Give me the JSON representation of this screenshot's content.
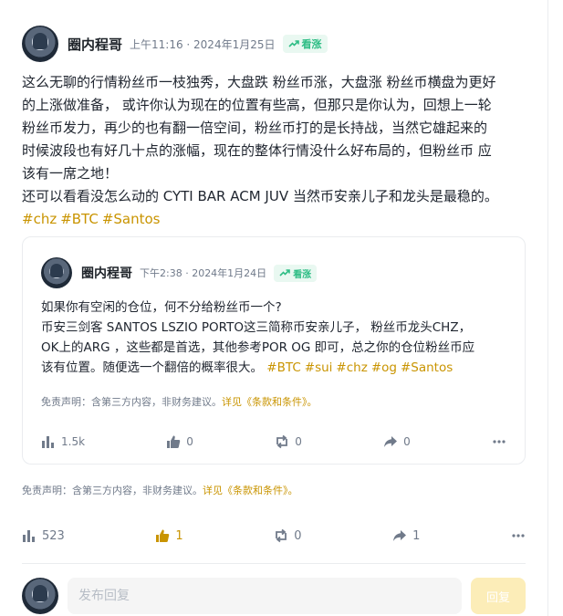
{
  "post": {
    "author": "圈内程哥",
    "time": "上午11:16 · 2024年1月25日",
    "sentiment": "看涨",
    "text_lines": [
      "这么无聊的行情粉丝币一枝独秀，大盘跌 粉丝币涨，大盘涨 粉丝币横盘为更好",
      "的上涨做准备， 或许你认为现在的位置有些高，但那只是你认为，回想上一轮",
      "粉丝币发力，再少的也有翻一倍空间，粉丝币打的是长持战，当然它雄起来的",
      "时候波段也有好几十点的涨幅，现在的整体行情没什么好布局的，但粉丝币 应",
      "该有一席之地！",
      "还可以看看没怎么动的 CYTI BAR ACM JUV 当然币安亲儿子和龙头是最稳的。"
    ],
    "tags": [
      "#chz",
      "#BTC",
      "#Santos"
    ],
    "disclaimer": "免责声明：含第三方内容，非财务建议。",
    "disclaimer_link": "详见《条款和条件》。",
    "stats": {
      "views": "523",
      "likes": "1",
      "reposts": "0",
      "shares": "1"
    }
  },
  "quoted": {
    "author": "圈内程哥",
    "time": "下午2:38 · 2024年1月24日",
    "sentiment": "看涨",
    "text_lines": [
      "如果你有空闲的仓位，何不分给粉丝币一个?",
      "币安三剑客 SANTOS LSZIO PORTO这三简称币安亲儿子， 粉丝币龙头CHZ，",
      "OK上的ARG ，这些都是首选，其他参考POR OG 即可，总之你的仓位粉丝币应"
    ],
    "last_line": "该有位置。随便选一个翻倍的概率很大。",
    "tags": [
      "#BTC",
      "#sui",
      "#chz",
      "#og",
      "#Santos"
    ],
    "disclaimer": "免责声明：含第三方内容，非财务建议。",
    "disclaimer_link": "详见《条款和条件》。",
    "stats": {
      "views": "1.5k",
      "likes": "0",
      "reposts": "0",
      "shares": "0"
    }
  },
  "reply": {
    "placeholder": "发布回复",
    "button": "回复"
  },
  "colors": {
    "accent": "#c99400",
    "bullish": "#2ebd85",
    "muted": "#707a8a"
  },
  "icons": [
    "trend-up-icon",
    "views-icon",
    "thumbs-up-icon",
    "repost-icon",
    "share-icon",
    "more-icon"
  ]
}
